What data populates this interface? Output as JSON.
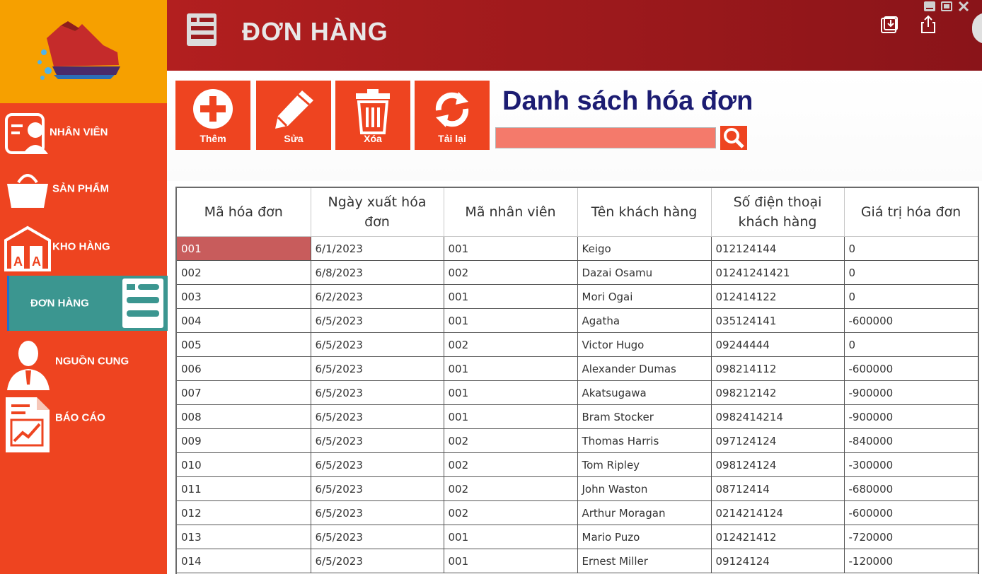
{
  "header": {
    "title": "ĐƠN HÀNG"
  },
  "sidebar": {
    "items": [
      {
        "label": "NHÂN VIÊN",
        "icon": "employee-icon"
      },
      {
        "label": "SẢN PHẨM",
        "icon": "shopping-bag-icon"
      },
      {
        "label": "KHO HÀNG",
        "icon": "warehouse-icon"
      },
      {
        "label": "ĐƠN HÀNG",
        "icon": "order-list-icon",
        "active": true
      },
      {
        "label": "NGUỒN CUNG",
        "icon": "supplier-person-icon"
      },
      {
        "label": "BÁO CÁO",
        "icon": "report-chart-icon"
      }
    ]
  },
  "toolbar": {
    "add_label": "Thêm",
    "edit_label": "Sửa",
    "delete_label": "Xóa",
    "reload_label": "Tải lại"
  },
  "list_title": "Danh sách hóa đơn",
  "search": {
    "value": ""
  },
  "colors": {
    "sidebar": "#ee4420",
    "logo_bg": "#f6a000",
    "header": "#a01b1f",
    "active_nav": "#3b9690",
    "title": "#1c1c72",
    "search_bg": "#f47a6b"
  },
  "table": {
    "columns": [
      "Mã hóa đơn",
      "Ngày xuất hóa đơn",
      "Mã nhân viên",
      "Tên khách hàng",
      "Số điện thoại khách hàng",
      "Giá trị hóa đơn"
    ],
    "rows": [
      [
        "001",
        "6/1/2023",
        "001",
        "Keigo",
        "012124144",
        "0"
      ],
      [
        "002",
        "6/8/2023",
        "002",
        "Dazai Osamu",
        "01241241421",
        "0"
      ],
      [
        "003",
        "6/2/2023",
        "001",
        "Mori Ogai",
        "012414122",
        "0"
      ],
      [
        "004",
        "6/5/2023",
        "001",
        "Agatha",
        "035124141",
        "-600000"
      ],
      [
        "005",
        "6/5/2023",
        "002",
        "Victor Hugo",
        "09244444",
        "0"
      ],
      [
        "006",
        "6/5/2023",
        "001",
        "Alexander Dumas",
        "098214112",
        "-600000"
      ],
      [
        "007",
        "6/5/2023",
        "001",
        "Akatsugawa",
        "098212142",
        "-900000"
      ],
      [
        "008",
        "6/5/2023",
        "001",
        "Bram Stocker",
        "0982414214",
        "-900000"
      ],
      [
        "009",
        "6/5/2023",
        "002",
        "Thomas Harris",
        "097124124",
        "-840000"
      ],
      [
        "010",
        "6/5/2023",
        "002",
        "Tom Ripley",
        "098124124",
        "-300000"
      ],
      [
        "011",
        "6/5/2023",
        "002",
        "John Waston",
        "08712414",
        "-680000"
      ],
      [
        "012",
        "6/5/2023",
        "002",
        "Arthur Moragan",
        "0214214124",
        "-600000"
      ],
      [
        "013",
        "6/5/2023",
        "001",
        "Mario Puzo",
        "012421412",
        "-720000"
      ],
      [
        "014",
        "6/5/2023",
        "001",
        "Ernest Miller",
        "09124124",
        "-120000"
      ]
    ]
  }
}
